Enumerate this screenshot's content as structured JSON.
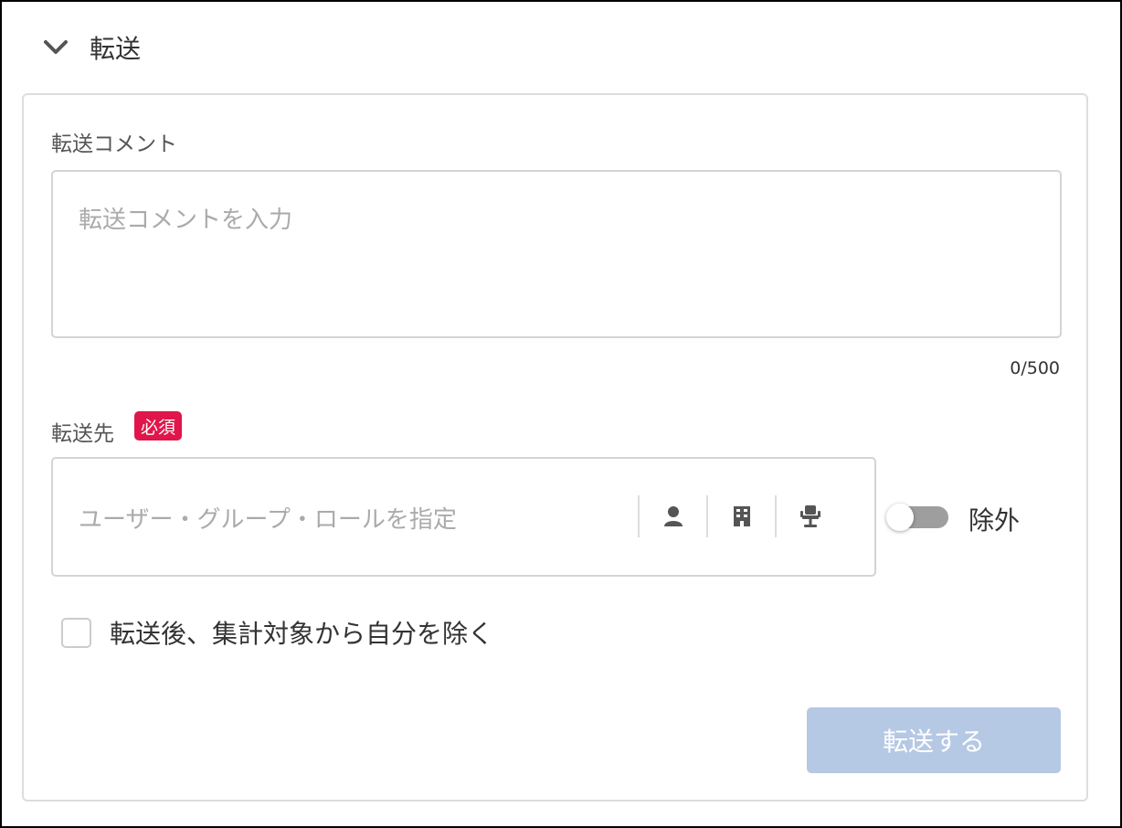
{
  "section": {
    "title": "転送",
    "chevron_icon": "chevron-down-icon"
  },
  "comment": {
    "label": "転送コメント",
    "placeholder": "転送コメントを入力",
    "counter": "0/500"
  },
  "destination": {
    "label": "転送先",
    "required_badge": "必須",
    "placeholder": "ユーザー・グループ・ロールを指定",
    "icons": [
      "user-icon",
      "building-icon",
      "role-seat-icon"
    ],
    "exclude_toggle_on": false,
    "exclude_label": "除外"
  },
  "options": {
    "exclude_self_label": "転送後、集計対象から自分を除く",
    "exclude_self_checked": false
  },
  "actions": {
    "submit_label": "転送する"
  },
  "colors": {
    "required_badge_bg": "#e0164a",
    "submit_disabled_bg": "#b5c8e4",
    "toggle_off_track": "#9e9e9e"
  }
}
